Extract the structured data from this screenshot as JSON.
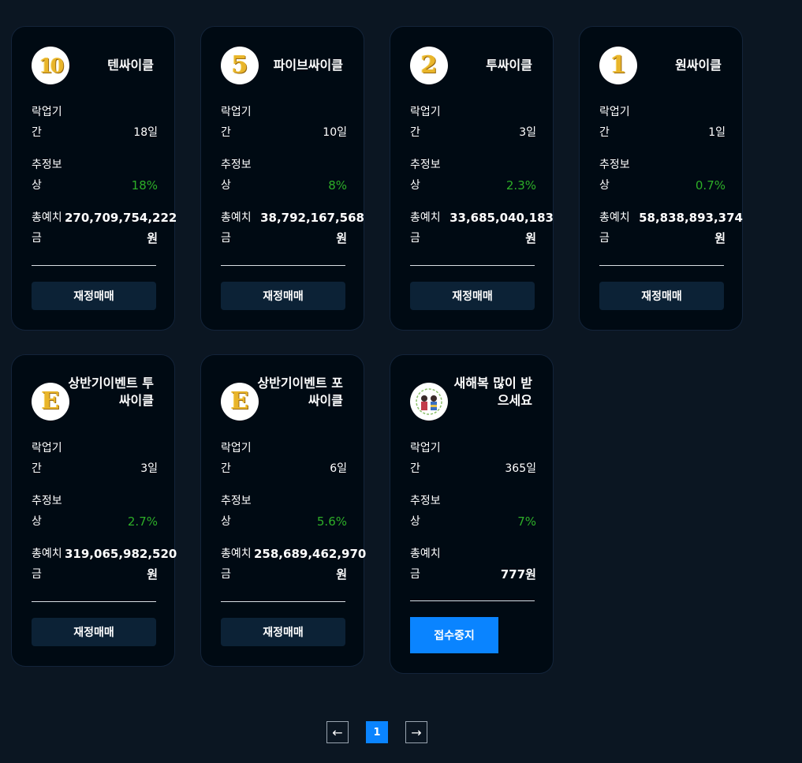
{
  "cards": [
    {
      "icon": "badge-ten-icon",
      "icon_text": "10",
      "title": "텐싸이클",
      "lockup_label": "락업기간",
      "lockup_value": "18일",
      "reward_label": "추정보상",
      "reward_value": "18%",
      "deposit_label": "총예치금",
      "deposit_value": "270,709,754,222",
      "deposit_unit": "원",
      "button": "재정매매"
    },
    {
      "icon": "badge-five-icon",
      "icon_text": "5",
      "title": "파이브싸이클",
      "lockup_label": "락업기간",
      "lockup_value": "10일",
      "reward_label": "추정보상",
      "reward_value": "8%",
      "deposit_label": "총예치금",
      "deposit_value": "38,792,167,568",
      "deposit_unit": "원",
      "button": "재정매매"
    },
    {
      "icon": "badge-two-icon",
      "icon_text": "2",
      "title": "투싸이클",
      "lockup_label": "락업기간",
      "lockup_value": "3일",
      "reward_label": "추정보상",
      "reward_value": "2.3%",
      "deposit_label": "총예치금",
      "deposit_value": "33,685,040,183",
      "deposit_unit": "원",
      "button": "재정매매"
    },
    {
      "icon": "badge-one-icon",
      "icon_text": "1",
      "title": "원싸이클",
      "lockup_label": "락업기간",
      "lockup_value": "1일",
      "reward_label": "추정보상",
      "reward_value": "0.7%",
      "deposit_label": "총예치금",
      "deposit_value": "58,838,893,374",
      "deposit_unit": "원",
      "button": "재정매매"
    },
    {
      "icon": "badge-e-icon",
      "icon_text": "E",
      "title": "상반기이벤트 투싸이클",
      "lockup_label": "락업기간",
      "lockup_value": "3일",
      "reward_label": "추정보상",
      "reward_value": "2.7%",
      "deposit_label": "총예치금",
      "deposit_value": "319,065,982,520",
      "deposit_unit": "원",
      "button": "재정매매"
    },
    {
      "icon": "badge-e-icon",
      "icon_text": "E",
      "title": "상반기이벤트 포싸이클",
      "lockup_label": "락업기간",
      "lockup_value": "6일",
      "reward_label": "추정보상",
      "reward_value": "5.6%",
      "deposit_label": "총예치금",
      "deposit_value": "258,689,462,970",
      "deposit_unit": "원",
      "button": "재정매매"
    },
    {
      "icon": "new-year-illustration-icon",
      "icon_text": "",
      "title": "새해복 많이 받으세요",
      "lockup_label": "락업기간",
      "lockup_value": "365일",
      "reward_label": "추정보상",
      "reward_value": "7%",
      "deposit_label": "총예치금",
      "deposit_value": "777원",
      "deposit_unit": "",
      "button": "접수중지"
    }
  ],
  "pagination": {
    "prev": "←",
    "current": "1",
    "next": "→"
  },
  "colors": {
    "background": "#0b1622",
    "card": "#000a13",
    "green": "#2dae28",
    "accent": "#0a84ff",
    "button": "#0c2236"
  }
}
